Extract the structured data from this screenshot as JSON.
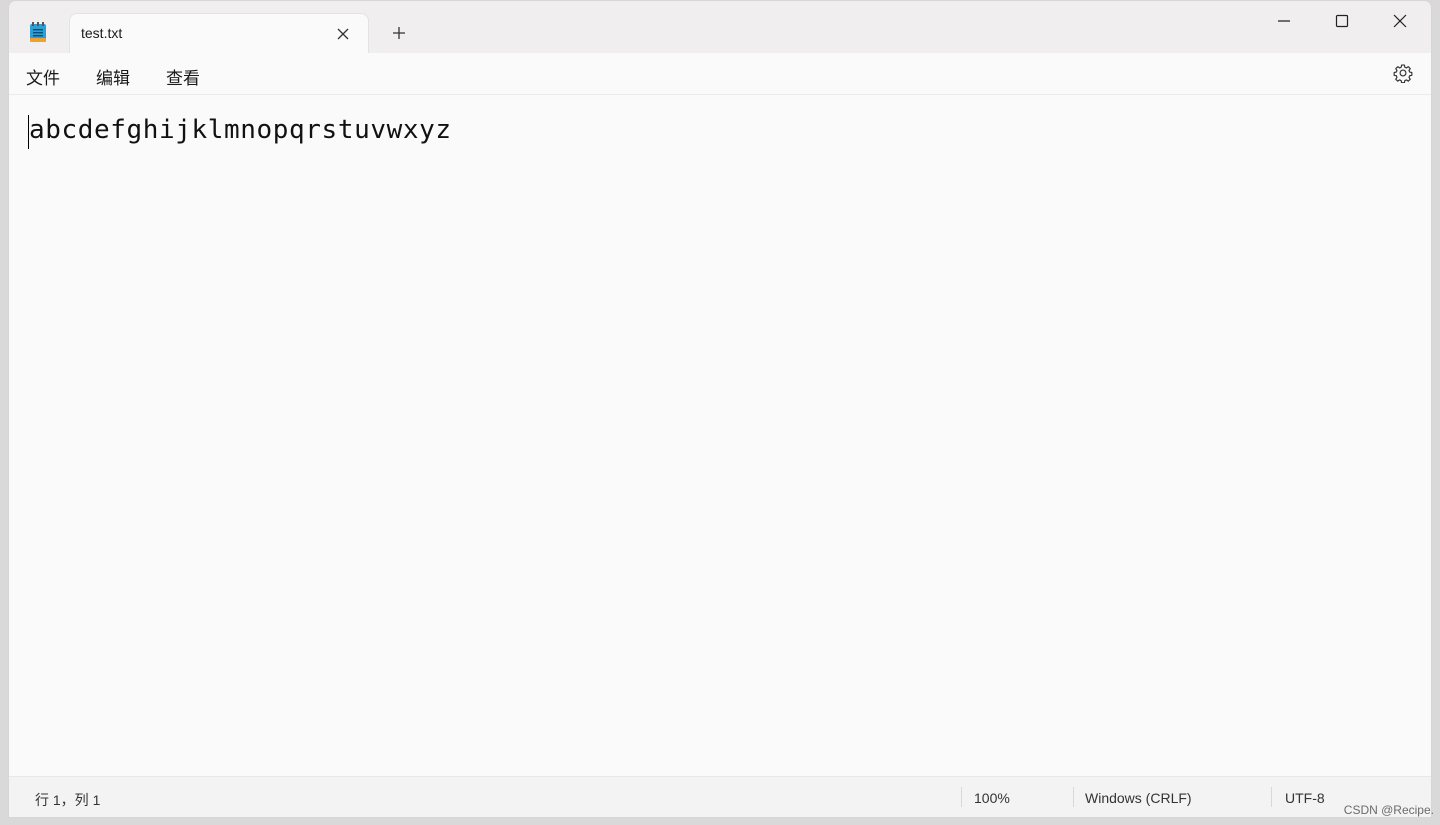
{
  "tab": {
    "title": "test.txt"
  },
  "menu": {
    "file": "文件",
    "edit": "编辑",
    "view": "查看"
  },
  "editor": {
    "text": "abcdefghijklmnopqrstuvwxyz"
  },
  "status": {
    "position": "行 1，列 1",
    "zoom": "100%",
    "line_ending": "Windows (CRLF)",
    "encoding": "UTF-8"
  },
  "watermark": "CSDN @Recipe.",
  "icons": {
    "app": "notepad-icon",
    "close_tab": "close-icon",
    "new_tab": "plus-icon",
    "minimize": "minimize-icon",
    "maximize": "maximize-icon",
    "close_window": "close-icon",
    "settings": "gear-icon"
  },
  "colors": {
    "app_icon": "#2b9fd8",
    "window_bg": "#fafafa",
    "titlebar_bg": "#f0eeee"
  }
}
